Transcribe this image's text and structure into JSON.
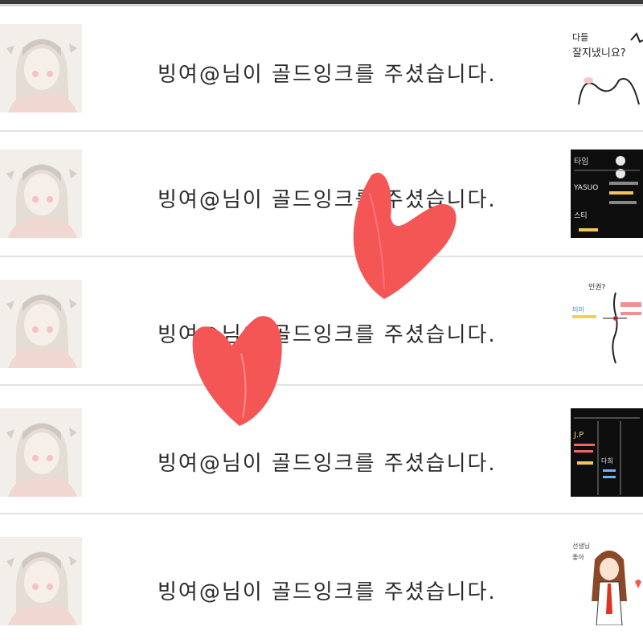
{
  "notifications": [
    {
      "message": "빙여@님이 골드잉크를 주셨습니다.",
      "thumb": {
        "lines": [
          "다들",
          "잘지냈니요?"
        ],
        "theme": "light"
      }
    },
    {
      "message": "빙여@님이 골드잉크를 주셨습니다.",
      "thumb": {
        "lines": [
          "타임",
          "YASUO",
          "스티"
        ],
        "theme": "dark"
      }
    },
    {
      "message": "빙여@님이 골드잉크를 주셨습니다.",
      "thumb": {
        "lines": [
          "인권?",
          "미미"
        ],
        "theme": "light"
      }
    },
    {
      "message": "빙여@님이 골드잉크를 주셨습니다.",
      "thumb": {
        "lines": [
          "J.P",
          "다희"
        ],
        "theme": "dark"
      }
    },
    {
      "message": "빙여@님이 골드잉크를 주셨습니다.",
      "thumb": {
        "lines": [
          "선생님",
          "좋아"
        ],
        "theme": "light"
      }
    }
  ],
  "colors": {
    "heart": "#f55555",
    "text": "#2b2b2b",
    "divider": "#e3e3e3"
  }
}
